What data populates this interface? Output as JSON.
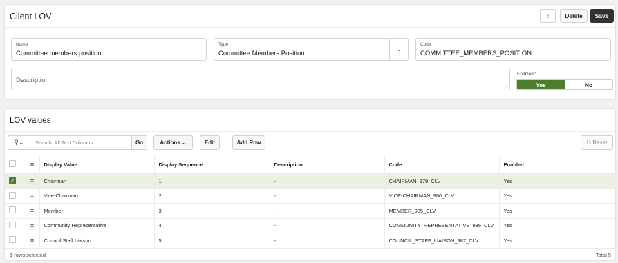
{
  "form": {
    "title": "Client LOV",
    "back_icon": "‹",
    "delete_label": "Delete",
    "save_label": "Save",
    "name": {
      "label": "Name",
      "value": "Committee members position"
    },
    "type": {
      "label": "Type",
      "value": "Committee Members Position"
    },
    "code": {
      "label": "Code",
      "value": "COMMITTEE_MEMBERS_POSITION"
    },
    "description": {
      "label": "Description",
      "value": ""
    },
    "enabled": {
      "label": "Enabled",
      "required_mark": "*",
      "yes": "Yes",
      "no": "No",
      "selected": "Yes"
    }
  },
  "grid": {
    "title": "LOV values",
    "search_placeholder": "Search: All Text Columns",
    "go_label": "Go",
    "actions_label": "Actions",
    "edit_label": "Edit",
    "add_row_label": "Add Row",
    "reset_label": "Reset",
    "columns": [
      "Display Value",
      "Display Sequence",
      "Description",
      "Code",
      "Enabled"
    ],
    "rows": [
      {
        "selected": true,
        "display_value": "Chairman",
        "sequence": "1",
        "description": "-",
        "code": "CHAIRMAN_979_CLV",
        "enabled": "Yes"
      },
      {
        "selected": false,
        "display_value": "Vice-Chairman",
        "sequence": "2",
        "description": "-",
        "code": "VICE-CHAIRMAN_980_CLV",
        "enabled": "Yes"
      },
      {
        "selected": false,
        "display_value": "Member",
        "sequence": "3",
        "description": "-",
        "code": "MEMBER_985_CLV",
        "enabled": "Yes"
      },
      {
        "selected": false,
        "display_value": "Community Representative",
        "sequence": "4",
        "description": "-",
        "code": "COMMUNITY_REPRESENTATIVE_986_CLV",
        "enabled": "Yes"
      },
      {
        "selected": false,
        "display_value": "Council Staff Liaison",
        "sequence": "5",
        "description": "-",
        "code": "COUNCIL_STAFF_LIAISON_987_CLV",
        "enabled": "Yes"
      }
    ],
    "selection_text": "1 rows selected",
    "total_text": "Total 5"
  },
  "colors": {
    "accent_green": "#4e7d2f",
    "save_dark": "#323232",
    "selected_row": "#e9f1e2"
  }
}
